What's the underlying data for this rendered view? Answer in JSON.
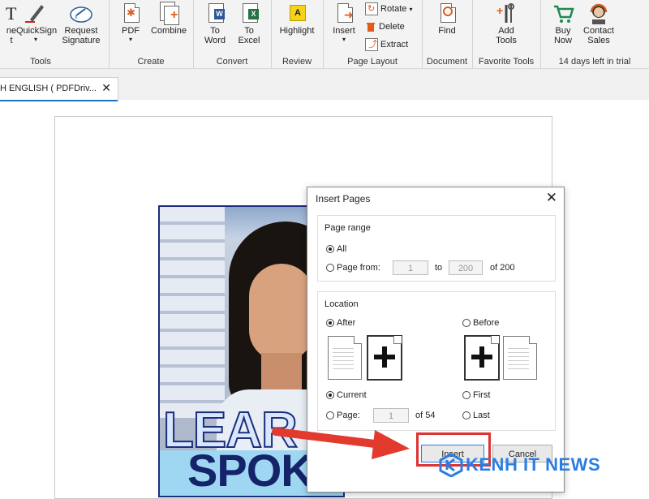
{
  "ribbon": {
    "groups": [
      {
        "label": "Tools",
        "buttons": [
          "ne\nt",
          "QuickSign",
          "Request\nSignature"
        ]
      },
      {
        "label": "Create",
        "buttons": [
          "PDF",
          "Combine"
        ]
      },
      {
        "label": "Convert",
        "buttons": [
          "To\nWord",
          "To\nExcel"
        ]
      },
      {
        "label": "Review",
        "buttons": [
          "Highlight"
        ]
      },
      {
        "label": "Page Layout",
        "buttons": [
          "Insert"
        ],
        "small_buttons": [
          "Rotate",
          "Delete",
          "Extract"
        ]
      },
      {
        "label": "Document",
        "buttons": [
          "Find"
        ]
      },
      {
        "label": "Favorite Tools",
        "buttons": [
          "Add\nTools"
        ]
      },
      {
        "label": "14 days left in trial",
        "buttons": [
          "Buy\nNow",
          "Contact\nSales"
        ]
      }
    ]
  },
  "tab": {
    "title": "H ENGLISH ( PDFDriv...",
    "close": "✕"
  },
  "document": {
    "cover_word_1": "LEAR",
    "cover_word_2": "SPOKEN"
  },
  "dialog": {
    "title": "Insert Pages",
    "close": "✕",
    "page_range": {
      "legend": "Page range",
      "all_label": "All",
      "page_from_label": "Page from:",
      "from_value": "1",
      "to_label": "to",
      "to_value": "200",
      "of_label": "of 200"
    },
    "location": {
      "legend": "Location",
      "after_label": "After",
      "before_label": "Before",
      "current_label": "Current",
      "first_label": "First",
      "page_label": "Page:",
      "page_value": "1",
      "of_label": "of 54",
      "last_label": "Last"
    },
    "insert_button": "Insert",
    "cancel_button": "Cancel"
  },
  "watermark": {
    "text": "KENH IT NEWS"
  },
  "colors": {
    "accent": "#1e73be",
    "highlight_red": "#dd3333",
    "watermark_blue": "#2a7de1"
  }
}
